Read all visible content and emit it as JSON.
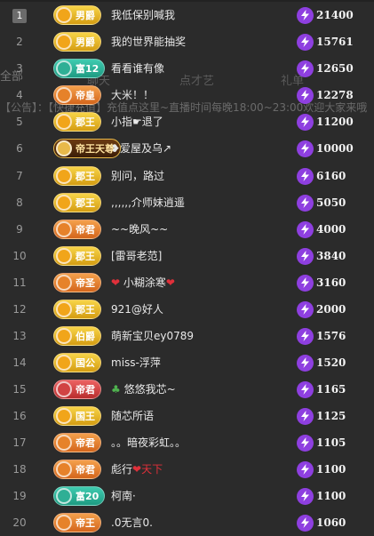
{
  "background": {
    "all_tab": "全部",
    "tabs": [
      "聊天",
      "点才艺",
      "礼单"
    ],
    "notice": "【公告】：【快捷充值】充值点这里~直播时间每晚18:00~23:00欢迎大家来哦"
  },
  "rows": [
    {
      "rank": "1",
      "badge": "男爵",
      "style": "gold",
      "name": "我低保别喊我",
      "score": "21400"
    },
    {
      "rank": "2",
      "badge": "男爵",
      "style": "gold",
      "name": "我的世界能抽奖",
      "score": "15761"
    },
    {
      "rank": "3",
      "badge": "富12",
      "style": "teal",
      "name": "看看谁有像",
      "score": "12650"
    },
    {
      "rank": "4",
      "badge": "帝皇",
      "style": "orange",
      "name": "大米！！",
      "score": "12278"
    },
    {
      "rank": "5",
      "badge": "郡王",
      "style": "gold",
      "name": "小指☛退了",
      "score": "11200"
    },
    {
      "rank": "6",
      "badge": "帝王天尊",
      "style": "emperor",
      "name": "❥爱屋及乌↗",
      "score": "10000"
    },
    {
      "rank": "7",
      "badge": "郡王",
      "style": "gold",
      "name": "别问，路过",
      "score": "6160"
    },
    {
      "rank": "8",
      "badge": "郡王",
      "style": "gold",
      "name": ",,,,,,介师妹逍遥",
      "score": "5050"
    },
    {
      "rank": "9",
      "badge": "帝君",
      "style": "orange",
      "name": "~~晚风~~",
      "score": "4000"
    },
    {
      "rank": "10",
      "badge": "郡王",
      "style": "gold",
      "name": "[雷哥老范]",
      "score": "3840"
    },
    {
      "rank": "11",
      "badge": "帝圣",
      "style": "orange",
      "name_prefix": "❤",
      "name": "小糊涂寒",
      "name_suffix": "❤",
      "score": "3160"
    },
    {
      "rank": "12",
      "badge": "郡王",
      "style": "gold",
      "name": "921@好人",
      "score": "2000"
    },
    {
      "rank": "13",
      "badge": "伯爵",
      "style": "gold",
      "name": "萌新宝贝ey0789",
      "score": "1576"
    },
    {
      "rank": "14",
      "badge": "国公",
      "style": "gold",
      "name": "miss-浮萍",
      "score": "1520"
    },
    {
      "rank": "15",
      "badge": "帝君",
      "style": "red",
      "name_prefix": "♣",
      "name": "悠悠我芯~",
      "score": "1165"
    },
    {
      "rank": "16",
      "badge": "国王",
      "style": "gold",
      "name": "随芯所语",
      "score": "1125"
    },
    {
      "rank": "17",
      "badge": "帝君",
      "style": "orange",
      "name": "。。暗夜彩虹。。",
      "score": "1105"
    },
    {
      "rank": "18",
      "badge": "帝君",
      "style": "orange",
      "name": "彪行",
      "name_suffix": "❤天下",
      "score": "1100"
    },
    {
      "rank": "19",
      "badge": "富20",
      "style": "teal",
      "name": "柯南·",
      "score": "1100"
    },
    {
      "rank": "20",
      "badge": "帝王",
      "style": "orange",
      "name": ".0无言0.",
      "score": "1060"
    }
  ]
}
